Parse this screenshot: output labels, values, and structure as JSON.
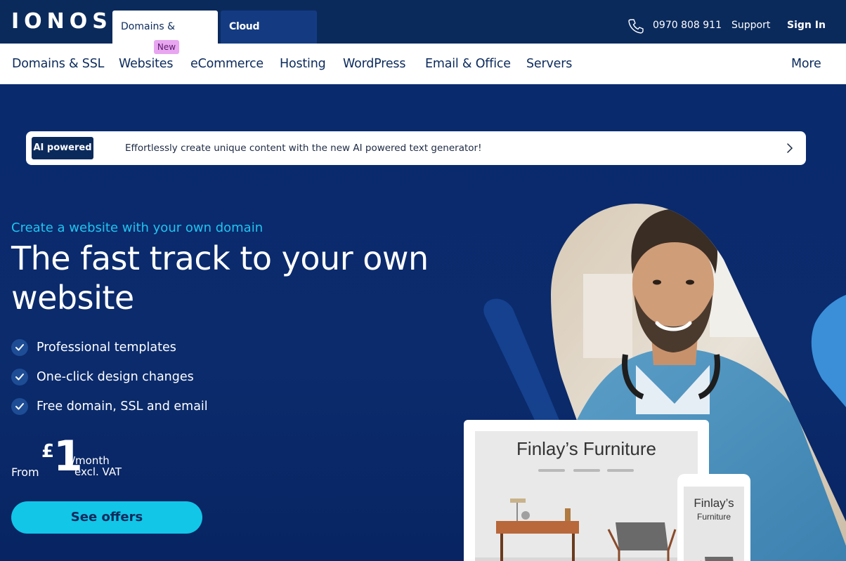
{
  "brand": {
    "logo": "IONOS"
  },
  "top_tabs": [
    {
      "label": "Domains & Hosting",
      "active": true
    },
    {
      "label": "Cloud Computing",
      "active": false
    }
  ],
  "top_right": {
    "phone_icon": "phone-icon",
    "phone": "0970 808 911",
    "support": "Support",
    "sign_in": "Sign In"
  },
  "nav": {
    "items": [
      "Domains & SSL",
      "Websites",
      "eCommerce",
      "Hosting",
      "WordPress",
      "Email & Office",
      "Servers"
    ],
    "more": "More",
    "new_badge": "New"
  },
  "ai_banner": {
    "badge": "AI powered",
    "text": "Effortlessly create unique content with the new AI powered text generator!",
    "chevron_icon": "chevron-right-icon"
  },
  "hero": {
    "kicker": "Create a website with your own domain",
    "headline": "The fast track to your own website",
    "features": [
      "Professional templates",
      "One-click design changes",
      "Free domain, SSL and email"
    ],
    "price": {
      "from": "From",
      "currency": "£",
      "amount": "1",
      "period": "/month",
      "vat": "excl. VAT"
    },
    "cta": "See offers"
  },
  "mockup": {
    "monitor_title": "Finlay’s Furniture",
    "phone_title": "Finlay’s",
    "phone_subtitle": "Furniture"
  },
  "colors": {
    "navy": "#0b2a5c",
    "hero_bg": "#0a2a6e",
    "accent_cyan": "#12c6e8",
    "kicker": "#20c4ef",
    "new_badge": "#e8a6f0"
  }
}
